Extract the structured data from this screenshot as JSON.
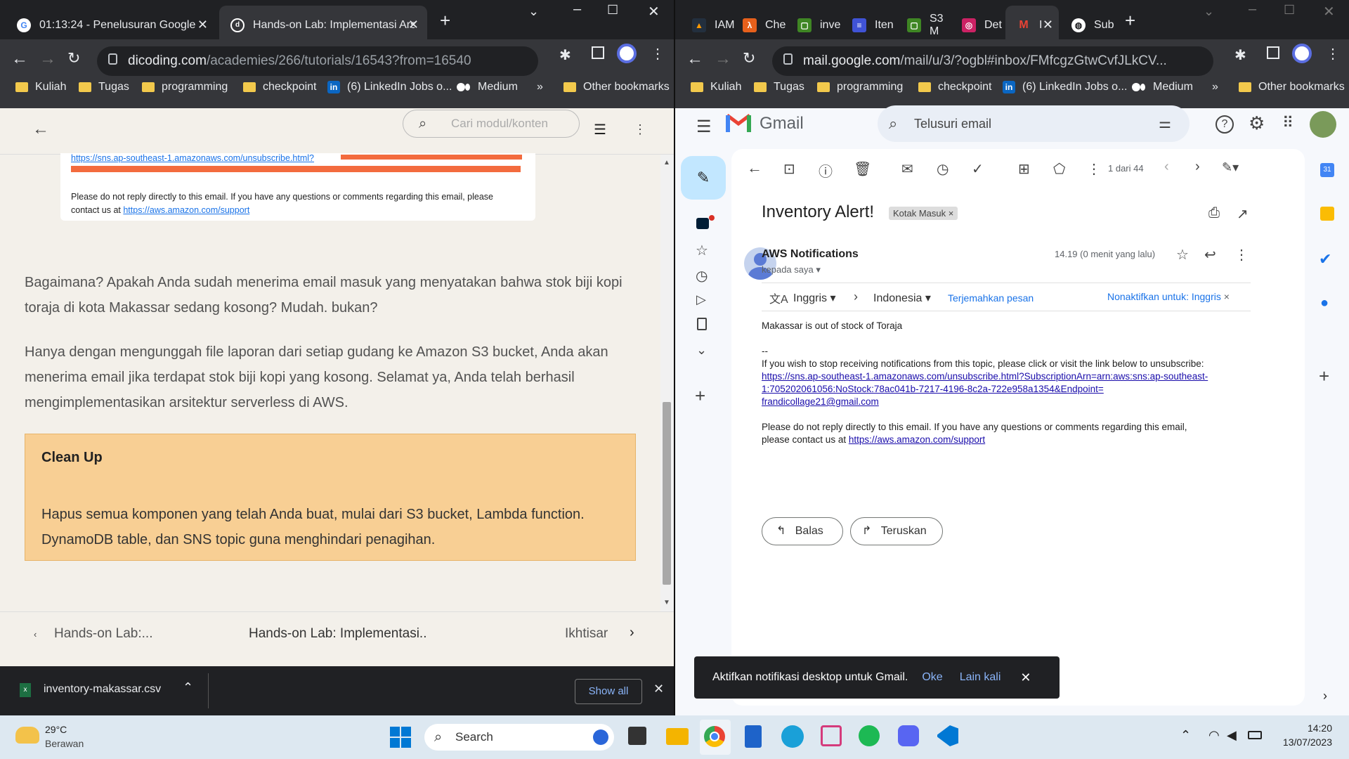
{
  "left_window": {
    "tabs": [
      {
        "title": "01:13:24 - Penelusuran Google",
        "active": false
      },
      {
        "title": "Hands-on Lab: Implementasi Arsi",
        "active": true
      }
    ],
    "url_host": "dicoding.com",
    "url_path": "/academies/266/tutorials/16543?from=16540",
    "bookmarks": [
      "Kuliah",
      "Tugas",
      "programming",
      "checkpoint",
      "(6) LinkedIn Jobs o...",
      "Medium"
    ],
    "bookmarks_more": "»",
    "other_bookmarks": "Other bookmarks",
    "search_placeholder": "Cari modul/konten",
    "email_snippet": {
      "unsubscribe_link": "https://sns.ap-southeast-1.amazonaws.com/unsubscribe.html?",
      "note": "Please do not reply directly to this email. If you have any questions or comments regarding this email, please",
      "note2_prefix": "contact us at ",
      "support_link": "https://aws.amazon.com/support"
    },
    "paragraph1": "Bagaimana? Apakah Anda sudah menerima email masuk yang menyatakan bahwa stok biji kopi toraja di kota Makassar sedang kosong? Mudah. bukan?",
    "paragraph2": "Hanya dengan mengunggah file laporan dari setiap gudang ke Amazon S3 bucket, Anda akan menerima email jika terdapat stok biji kopi yang kosong. Selamat ya, Anda telah berhasil mengimplementasikan arsitektur serverless di AWS.",
    "callout_title": "Clean Up",
    "callout_body": "Hapus semua komponen yang telah Anda buat, mulai dari S3 bucket, Lambda function. DynamoDB table, dan SNS topic guna menghindari penagihan.",
    "pager": {
      "prev": "Hands-on Lab:...",
      "current": "Hands-on Lab: Implementasi..",
      "next": "Ikhtisar"
    },
    "download": {
      "file": "inventory-makassar.csv",
      "show_all": "Show all"
    }
  },
  "right_window": {
    "tabs": [
      "IAM",
      "Che",
      "inve",
      "Iten",
      "S3 M",
      "Det",
      "I",
      "Sub"
    ],
    "url_host": "mail.google.com",
    "url_path": "/mail/u/3/?ogbl#inbox/FMfcgzGtwCvfJLkCV...",
    "bookmarks": [
      "Kuliah",
      "Tugas",
      "programming",
      "checkpoint",
      "(6) LinkedIn Jobs o...",
      "Medium"
    ],
    "bookmarks_more": "»",
    "other_bookmarks": "Other bookmarks",
    "gmail_logo": "Gmail",
    "search_placeholder": "Telusuri email",
    "pagination": "1 dari 44",
    "subject": "Inventory Alert!",
    "label": "Kotak Masuk",
    "sender": "AWS Notifications",
    "to": "kepada saya",
    "time": "14.19 (0 menit yang lalu)",
    "translate": {
      "from": "Inggris",
      "to": "Indonesia",
      "action": "Terjemahkan pesan",
      "disable": "Nonaktifkan untuk: Inggris"
    },
    "body": {
      "line1": "Makassar is out of stock of Toraja",
      "sep": "--",
      "unsub_text": "If you wish to stop receiving notifications from this topic, please click or visit the link below to unsubscribe:",
      "unsub_link_1": "https://sns.ap-southeast-1.amazonaws.com/unsubscribe.html?SubscriptionArn=arn:aws:sns:ap-southeast-",
      "unsub_link_2": "1:705202061056:NoStock:78ac041b-7217-4196-8c2a-722e958a1354&Endpoint=",
      "unsub_link_3": "frandicollage21@gmail.com",
      "note1": "Please do not reply directly to this email. If you have any questions or comments regarding this email,",
      "note2_prefix": "please contact us at ",
      "support_link": "https://aws.amazon.com/support"
    },
    "reply": "Balas",
    "forward": "Teruskan",
    "snackbar": {
      "text": "Aktifkan notifikasi desktop untuk Gmail.",
      "ok": "Oke",
      "later": "Lain kali"
    }
  },
  "taskbar": {
    "weather_temp": "29°C",
    "weather_desc": "Berawan",
    "search": "Search",
    "time": "14:20",
    "date": "13/07/2023"
  }
}
